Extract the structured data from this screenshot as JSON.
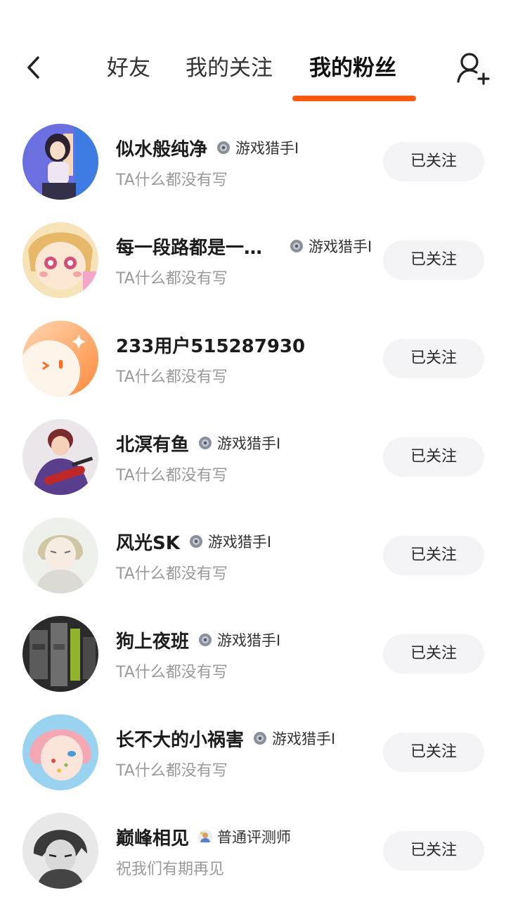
{
  "header": {
    "tabs": [
      {
        "label": "好友",
        "active": false
      },
      {
        "label": "我的关注",
        "active": false
      },
      {
        "label": "我的粉丝",
        "active": true
      }
    ],
    "accent_color": "#ff5a0e"
  },
  "fans": [
    {
      "name": "似水般纯净",
      "badge": "游戏猎手I",
      "badge_icon": "gear-badge-icon",
      "bio": "TA什么都没有写",
      "button": "已关注"
    },
    {
      "name": "每一段路都是一…",
      "badge": "游戏猎手I",
      "badge_icon": "gear-badge-icon",
      "bio": "TA什么都没有写",
      "button": "已关注"
    },
    {
      "name": "233用户515287930",
      "badge": "",
      "bio": "TA什么都没有写",
      "button": "已关注"
    },
    {
      "name": "北溟有鱼",
      "badge": "游戏猎手I",
      "badge_icon": "gear-badge-icon",
      "bio": "TA什么都没有写",
      "button": "已关注"
    },
    {
      "name": "风光SK",
      "badge": "游戏猎手I",
      "badge_icon": "gear-badge-icon",
      "bio": "TA什么都没有写",
      "button": "已关注"
    },
    {
      "name": "狗上夜班",
      "badge": "游戏猎手I",
      "badge_icon": "gear-badge-icon",
      "bio": "TA什么都没有写",
      "button": "已关注"
    },
    {
      "name": "长不大的小祸害",
      "badge": "游戏猎手I",
      "badge_icon": "gear-badge-icon",
      "bio": "TA什么都没有写",
      "button": "已关注"
    },
    {
      "name": "巅峰相见",
      "badge": "普通评测师",
      "badge_icon": "reviewer-badge-icon",
      "bio": "祝我们有期再见",
      "button": "已关注"
    }
  ]
}
